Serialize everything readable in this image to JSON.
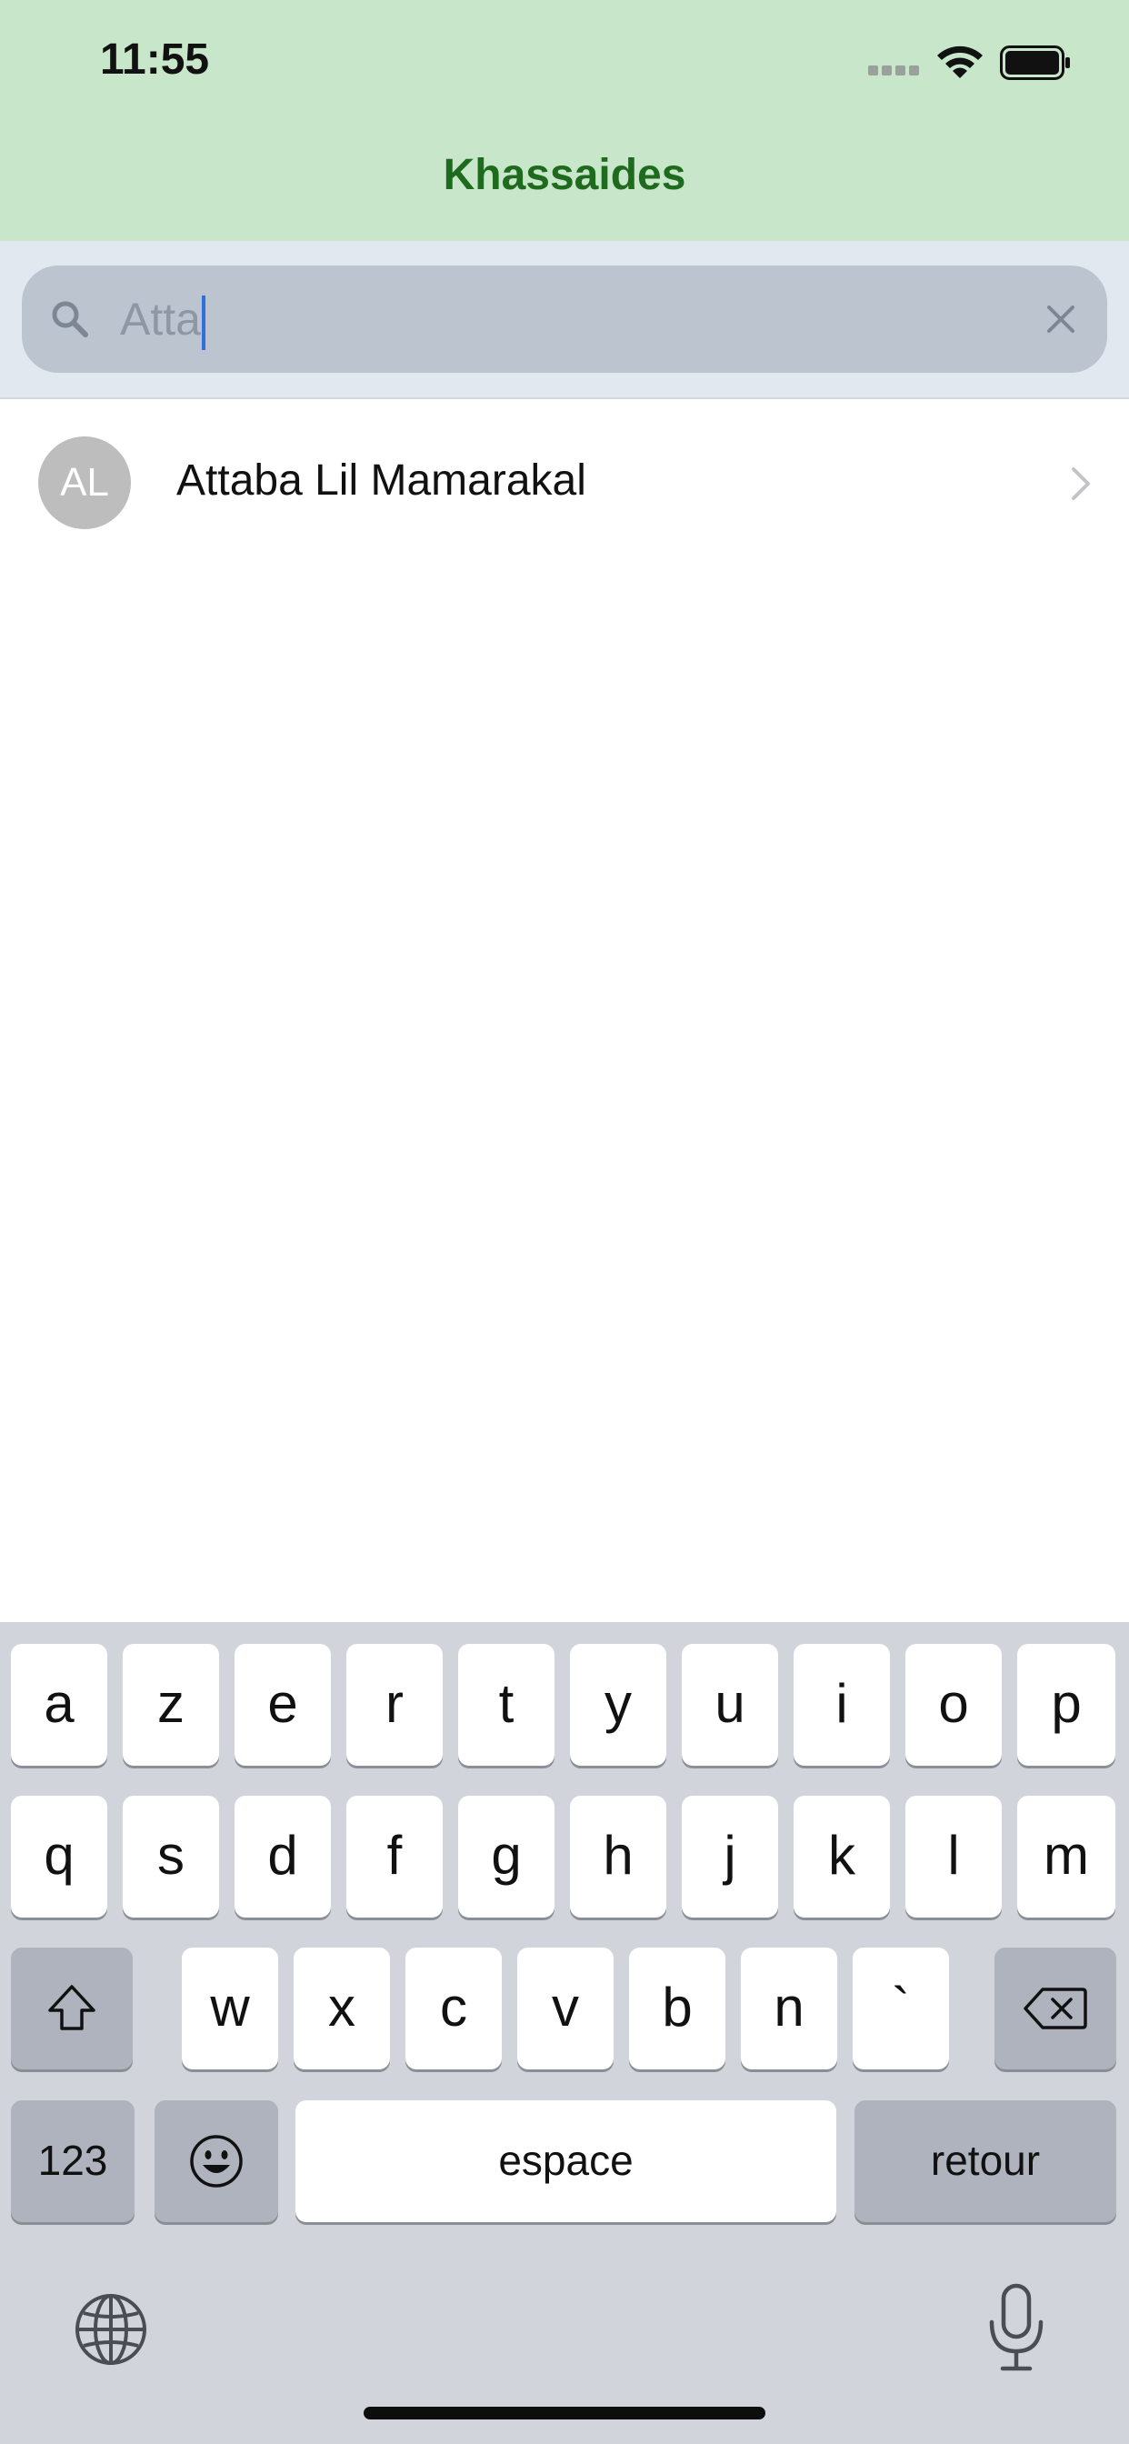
{
  "status_bar": {
    "time": "11:55"
  },
  "nav": {
    "title": "Khassaides"
  },
  "search": {
    "value": "Atta"
  },
  "results": [
    {
      "initials": "AL",
      "title": "Attaba Lil Mamarakal"
    }
  ],
  "keyboard": {
    "row1": [
      "a",
      "z",
      "e",
      "r",
      "t",
      "y",
      "u",
      "i",
      "o",
      "p"
    ],
    "row2": [
      "q",
      "s",
      "d",
      "f",
      "g",
      "h",
      "j",
      "k",
      "l",
      "m"
    ],
    "row3": [
      "w",
      "x",
      "c",
      "v",
      "b",
      "n",
      "`"
    ],
    "numbers_label": "123",
    "space_label": "espace",
    "return_label": "retour"
  },
  "colors": {
    "header_bg": "#c8e6c9",
    "title_green": "#1e6b1e",
    "search_bg": "#bcc4cf",
    "caret_blue": "#2f6fe0"
  }
}
